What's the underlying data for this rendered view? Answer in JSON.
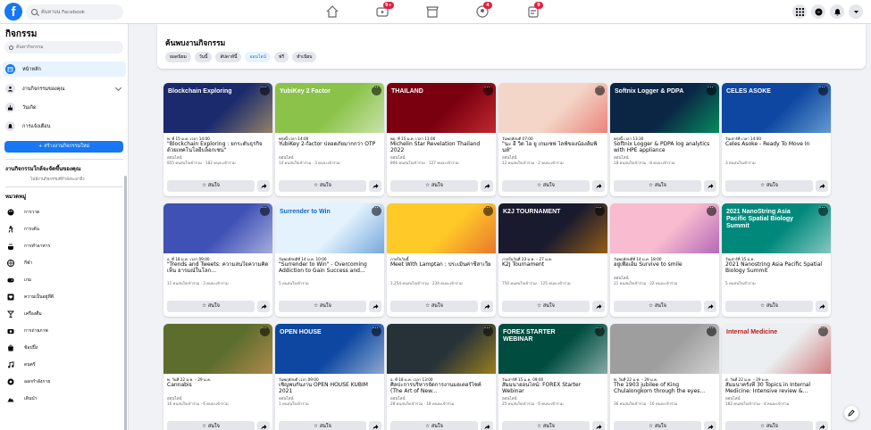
{
  "topbar": {
    "search_placeholder": "ค้นหาบน Facebook",
    "badges": {
      "watch": "9+",
      "groups": "4",
      "gaming": "9"
    }
  },
  "sidebar": {
    "title": "กิจกรรม",
    "search_placeholder": "ค้นหากิจกรรม",
    "items": [
      {
        "label": "หน้าหลัก",
        "icon": "calendar-icon",
        "active": true
      },
      {
        "label": "งานกิจกรรมของคุณ",
        "icon": "person-icon",
        "active": false
      },
      {
        "label": "วันเกิด",
        "icon": "cake-icon",
        "active": false
      },
      {
        "label": "การแจ้งเตือน",
        "icon": "bell-icon",
        "active": false
      }
    ],
    "create_label": "+ สร้างงานกิจกรรมใหม่",
    "location_heading": "งานกิจกรรมใกล้จะจัดขึ้นของคุณ",
    "location_sub": "ไม่มีงานกิจกรรมที่กำลังจะมาถึง",
    "categories_heading": "หมวดหมู่",
    "categories": [
      {
        "label": "การวาด",
        "icon": "palette-icon"
      },
      {
        "label": "การเต้น",
        "icon": "dance-icon"
      },
      {
        "label": "การทำอาหาร",
        "icon": "cooking-icon"
      },
      {
        "label": "กีฬา",
        "icon": "ball-icon"
      },
      {
        "label": "เกม",
        "icon": "game-icon"
      },
      {
        "label": "ความเป็นอยู่ที่ดี",
        "icon": "heart-icon"
      },
      {
        "label": "เครื่องดื่ม",
        "icon": "drink-icon"
      },
      {
        "label": "การถ่ายภาพ",
        "icon": "camera-icon"
      },
      {
        "label": "ช้อปปิ้ง",
        "icon": "shopping-icon"
      },
      {
        "label": "ดนตรี",
        "icon": "music-icon"
      },
      {
        "label": "ออกกำลังกาย",
        "icon": "fitness-icon"
      },
      {
        "label": "เดินป่า",
        "icon": "hiking-icon"
      }
    ]
  },
  "main": {
    "title": "ค้นพบงานกิจกรรม",
    "chips": [
      {
        "label": "ยอดนิยม",
        "active": false
      },
      {
        "label": "วันนี้",
        "active": false
      },
      {
        "label": "สัปดาห์นี้",
        "active": false
      },
      {
        "label": "ออนไลน์",
        "active": true
      },
      {
        "label": "ฟรี",
        "active": false
      },
      {
        "label": "ทำเนียบ",
        "active": false
      }
    ],
    "interested_label": "☆ สนใจ",
    "cards": [
      {
        "date": "พ. ที่ 15 ม.ค. เวลา 14:00",
        "title": "\"Blockchain Exploring : ยกระดับธุรกิจด้วยเทคโนโลยีบล็อกเชน\"",
        "loc": "ออนไลน์",
        "stats": "855 คนสนใจเข้าร่วม · 182 คนจะเข้าร่วม",
        "bg": "#1a2a6c",
        "accent": "#ffd166",
        "banner": "Blockchain Exploring"
      },
      {
        "date": "พรุ่งนี้ เวลา 14:00",
        "title": "YubiKey 2-factor ปลอดภัยมากกว่า OTP",
        "loc": "ออนไลน์",
        "stats": "14 คนสนใจเข้าร่วม · 3 คนจะเข้าร่วม",
        "bg": "#8bc34a",
        "accent": "#ffffff",
        "banner": "YubiKey 2 Factor"
      },
      {
        "date": "พฤ. ที่ 15 ม.ค. เวลา 11:00",
        "title": "Michelin Star Revelation Thailand 2022",
        "loc": "ออนไลน์",
        "stats": "806 คนสนใจเข้าร่วม · 127 คนจะเข้าร่วม",
        "bg": "#7a0010",
        "accent": "#ff4d4d",
        "banner": "THAILAND"
      },
      {
        "date": "วันพฤหัสบดี 07:00",
        "title": "\"นะ อี วิด ไอ ยู เกมเซฟ ไลฟ์ของน้องส้มพินท์\"",
        "loc": "ออนไลน์",
        "stats": "12 คนสนใจเข้าร่วม · 2 คนจะเข้าร่วม",
        "bg": "#f3d6c8",
        "accent": "#e53935",
        "banner": ""
      },
      {
        "date": "พรุ่งนี้ เวลา 13:30",
        "title": "Softnix Logger & PDPA log analytics with HPE appliance",
        "loc": "ออนไลน์",
        "stats": "18 คนสนใจเข้าร่วม · 8 คนจะเข้าร่วม",
        "bg": "#0b2545",
        "accent": "#00e676",
        "banner": "Softnix Logger & PDPA"
      },
      {
        "date": "วันเสาร์ที่ เวลา 14:00",
        "title": "Celes Asoke - Ready To Move In",
        "loc": "",
        "stats": "3 คนสนใจเข้าร่วม",
        "bg": "#0d47a1",
        "accent": "#b3e5fc",
        "banner": "CELES ASOKE"
      },
      {
        "date": "อ. ที่ 18 ม.ค. เวลา 09:00",
        "title": "\"Trends and Tweets: ความสนใจความคิดเห็น อารมณ์ในโลก...",
        "loc": "",
        "stats": "11 คนสนใจเข้าร่วม · 3 คนจะเข้าร่วม",
        "bg": "#3f51b5",
        "accent": "#ffffff",
        "banner": ""
      },
      {
        "date": "วันพฤหัสบดีที่ 14 ม.ค. 10:00",
        "title": "\"Surrender to Win\" - Overcoming Addiction to Gain Success and...",
        "loc": "",
        "stats": "5 คนสนใจเข้าร่วม",
        "bg": "#e3f2fd",
        "accent": "#1565c0",
        "banner": "Surrender to Win"
      },
      {
        "date": "ภายในวันนี้",
        "title": "Meet With Lamptan : ประเมินค่าชีสาเวีย",
        "loc": "",
        "stats": "1,254 คนสนใจเข้าร่วม · 234 คนจะเข้าร่วม",
        "bg": "#ffca28",
        "accent": "#d32f2f",
        "banner": ""
      },
      {
        "date": "ภายในวันที่ 23 ม.ค. – 27 ม.ค.",
        "title": "K2J Tournament",
        "loc": "",
        "stats": "750 คนสนใจเข้าร่วม · 125 คนจะเข้าร่วม",
        "bg": "#1a1a2e",
        "accent": "#ff9800",
        "banner": "K2J TOURNAMENT"
      },
      {
        "date": "วันพฤหัสบดีที่ 14 ม.ค. 18:00",
        "title": "อยู่เพื่อเอ้ม Survive to smile",
        "loc": "ออนไลน์",
        "stats": "21 คนสนใจเข้าร่วม · 22 คนจะเข้าร่วม",
        "bg": "#f8bbd0",
        "accent": "#7b1fa2",
        "banner": ""
      },
      {
        "date": "วันเสาร์ที่ 15 ม.ค.",
        "title": "2021 Nanostring Asia Pacific Spatial Biology Summit",
        "loc": "",
        "stats": "5 คนสนใจเข้าร่วม",
        "bg": "#00897b",
        "accent": "#ffffff",
        "banner": "2021 NanoString Asia Pacific Spatial Biology Summit"
      },
      {
        "date": "พ. วันที่ 22 ม.ค. – 29 ม.ค.",
        "title": "Cannabis",
        "loc": "ออนไลน์",
        "stats": "16 คนสนใจเข้าร่วม · 6 คนจะเข้าร่วม",
        "bg": "#5d6d2e",
        "accent": "#f4a261",
        "banner": ""
      },
      {
        "date": "วันพฤหัสบดี เวลา 09:00",
        "title": "เชิญพบกันงาน OPEN HOUSE KUBIM 2021",
        "loc": "ออนไลน์",
        "stats": "1 คนสนใจเข้าร่วม",
        "bg": "#0d47a1",
        "accent": "#ffffff",
        "banner": "OPEN HOUSE"
      },
      {
        "date": "อ. ที่ 18 ม.ค. เวลา 13:00",
        "title": "ศิลปะการบริหารจัดการงานมอเตอร์ไซค์ (The Art of New...",
        "loc": "ออนไลน์",
        "stats": "28 คนสนใจเข้าร่วม · 18 คนจะเข้าร่วม",
        "bg": "#263238",
        "accent": "#ffc107",
        "banner": ""
      },
      {
        "date": "วันเสาร์ที่ 15 ม.ค. 09:00",
        "title": "สัมมนาออนไลน์: FOREX Starter Webinar",
        "loc": "ออนไลน์",
        "stats": "25 คนสนใจเข้าร่วม · 6 คนจะเข้าร่วม",
        "bg": "#004d40",
        "accent": "#ffffff",
        "banner": "FOREX STARTER WEBINAR"
      },
      {
        "date": "พ. วันที่ 22 ม.ค. – 29 ม.ค.",
        "title": "The 1903 jubilee of King Chulalongkorn through the eyes...",
        "loc": "",
        "stats": "36 คนสนใจเข้าร่วม · 16 คนจะเข้าร่วม",
        "bg": "#9e9e9e",
        "accent": "#ffffff",
        "banner": ""
      },
      {
        "date": "ส. วันที่ 22 ม.ค. – 29 ม.ค.",
        "title": "สัมมนาครั้งที่ 30 Topics in Internal Medicine: Intensive review &...",
        "loc": "ออนไลน์",
        "stats": "182 คนสนใจเข้าร่วม · 4 คนจะเข้าร่วม",
        "bg": "#eceff1",
        "accent": "#b71c1c",
        "banner": "Internal Medicine"
      }
    ]
  }
}
